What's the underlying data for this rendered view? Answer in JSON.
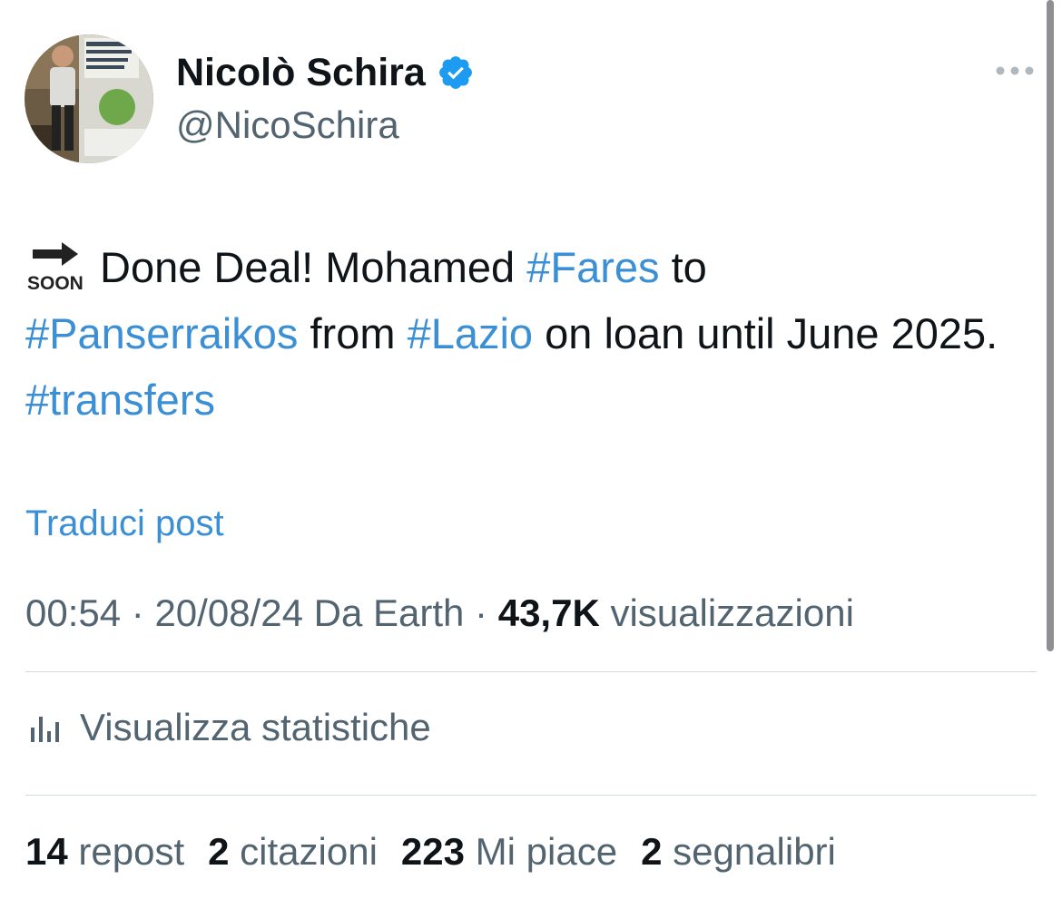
{
  "author": {
    "name": "Nicolò Schira",
    "handle": "@NicoSchira",
    "verified": true
  },
  "tweet": {
    "emoji": "soon-arrow-icon",
    "segments": [
      {
        "text": "Done Deal! Mohamed ",
        "type": "text"
      },
      {
        "text": "#Fares",
        "type": "hashtag"
      },
      {
        "text": " to ",
        "type": "text"
      },
      {
        "text": "#Panserraikos",
        "type": "hashtag"
      },
      {
        "text": " from ",
        "type": "text"
      },
      {
        "text": "#Lazio",
        "type": "hashtag"
      },
      {
        "text": " on loan until June 2025. ",
        "type": "text"
      },
      {
        "text": "#transfers",
        "type": "hashtag"
      }
    ]
  },
  "translate_label": "Traduci post",
  "meta": {
    "time": "00:54",
    "separator": "·",
    "date": "20/08/24",
    "source": "Da Earth",
    "views_count": "43,7K",
    "views_label": "visualizzazioni"
  },
  "stats_link": "Visualizza statistiche",
  "engagement": {
    "reposts_count": "14",
    "reposts_label": "repost",
    "quotes_count": "2",
    "quotes_label": "citazioni",
    "likes_count": "223",
    "likes_label": "Mi piace",
    "bookmarks_count": "2",
    "bookmarks_label": "segnalibri"
  },
  "colors": {
    "accent": "#3b8fd4",
    "secondary_text": "#536471",
    "primary_text": "#0f1419",
    "verified": "#1d9bf0"
  }
}
